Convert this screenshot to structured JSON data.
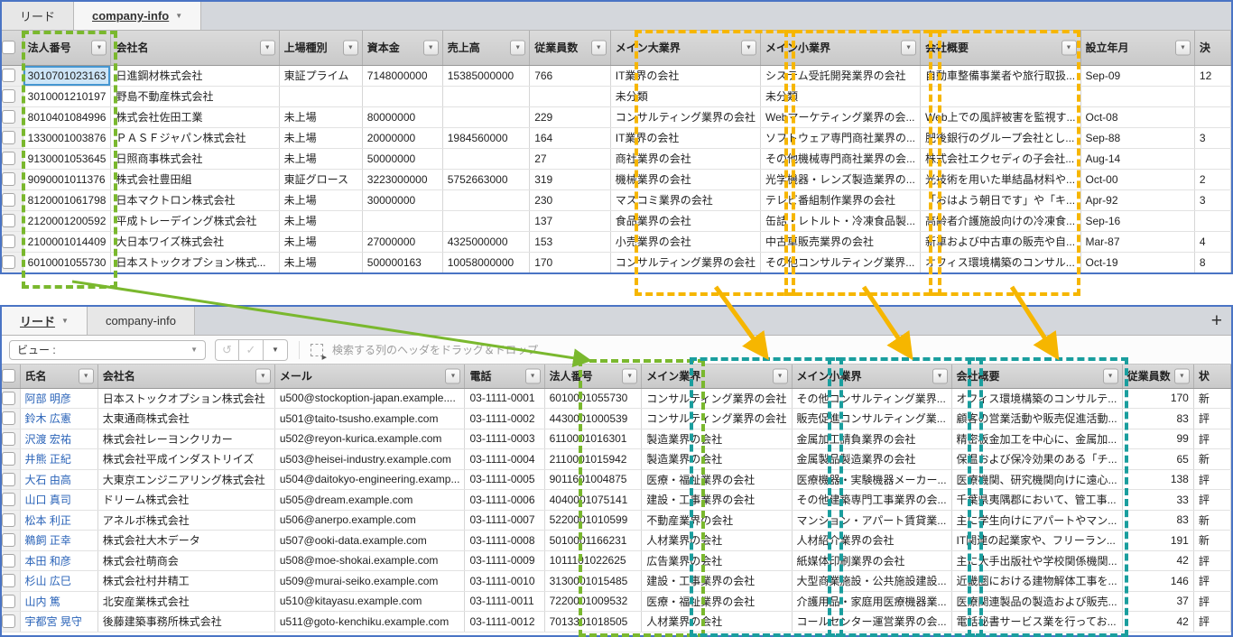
{
  "colors": {
    "panel_border": "#4a74c4",
    "green": "#7ab82e",
    "yellow": "#f6b600",
    "teal": "#1a9e9e",
    "link": "#2a63b8",
    "selected_cell_bg": "#cde5f7",
    "selected_cell_border": "#4596d1"
  },
  "top_panel": {
    "tabs": [
      {
        "id": "lead",
        "label": "リード",
        "active": false,
        "caret": false
      },
      {
        "id": "company-info",
        "label": "company-info",
        "active": true,
        "caret": true
      }
    ],
    "columns": [
      {
        "id": "corporate-number",
        "label": "法人番号"
      },
      {
        "id": "company-name",
        "label": "会社名"
      },
      {
        "id": "listing-type",
        "label": "上場種別"
      },
      {
        "id": "capital",
        "label": "資本金"
      },
      {
        "id": "revenue",
        "label": "売上高"
      },
      {
        "id": "employees",
        "label": "従業員数"
      },
      {
        "id": "main-major-industry",
        "label": "メイン大業界"
      },
      {
        "id": "main-minor-industry",
        "label": "メイン小業界"
      },
      {
        "id": "company-overview",
        "label": "会社概要"
      },
      {
        "id": "founded",
        "label": "設立年月"
      },
      {
        "id": "fiscal-month",
        "label": "決",
        "cut": true
      }
    ],
    "rows": [
      [
        "3010701023163",
        "日進鋼材株式会社",
        "東証プライム",
        "7148000000",
        "15385000000",
        "766",
        "IT業界の会社",
        "システム受託開発業界の会社",
        "自動車整備事業者や旅行取扱...",
        "Sep-09",
        "12"
      ],
      [
        "3010001210197",
        "野島不動産株式会社",
        "",
        "",
        "",
        "",
        "未分類",
        "未分類",
        "",
        "",
        ""
      ],
      [
        "8010401084996",
        "株式会社佐田工業",
        "未上場",
        "80000000",
        "",
        "229",
        "コンサルティング業界の会社",
        "Webマーケティング業界の会...",
        "Web上での風評被害を監視す...",
        "Oct-08",
        ""
      ],
      [
        "1330001003876",
        "ＰＡＳＦジャパン株式会社",
        "未上場",
        "20000000",
        "1984560000",
        "164",
        "IT業界の会社",
        "ソフトウェア専門商社業界の...",
        "肥後銀行のグループ会社とし...",
        "Sep-88",
        "3"
      ],
      [
        "9130001053645",
        "日照商事株式会社",
        "未上場",
        "50000000",
        "",
        "27",
        "商社業界の会社",
        "その他機械専門商社業界の会...",
        "株式会社エクセディの子会社...",
        "Aug-14",
        ""
      ],
      [
        "9090001011376",
        "株式会社豊田組",
        "東証グロース",
        "3223000000",
        "5752663000",
        "319",
        "機械業界の会社",
        "光学機器・レンズ製造業界の...",
        "光技術を用いた単結晶材料や...",
        "Oct-00",
        "2"
      ],
      [
        "8120001061798",
        "日本マクトロン株式会社",
        "未上場",
        "30000000",
        "",
        "230",
        "マスコミ業界の会社",
        "テレビ番組制作業界の会社",
        "「おはよう朝日です」や「キ...",
        "Apr-92",
        "3"
      ],
      [
        "2120001200592",
        "平成トレーデイング株式会社",
        "未上場",
        "",
        "",
        "137",
        "食品業界の会社",
        "缶詰・レトルト・冷凍食品製...",
        "高齢者介護施設向けの冷凍食...",
        "Sep-16",
        ""
      ],
      [
        "2100001014409",
        "大日本ワイズ株式会社",
        "未上場",
        "27000000",
        "4325000000",
        "153",
        "小売業界の会社",
        "中古車販売業界の会社",
        "新車および中古車の販売や自...",
        "Mar-87",
        "4"
      ],
      [
        "6010001055730",
        "日本ストックオプション株式...",
        "未上場",
        "500000163",
        "10058000000",
        "170",
        "コンサルティング業界の会社",
        "その他コンサルティング業界...",
        "オフィス環境構築のコンサル...",
        "Oct-19",
        "8"
      ]
    ]
  },
  "bottom_panel": {
    "tabs": [
      {
        "id": "lead",
        "label": "リード",
        "active": true,
        "caret": true
      },
      {
        "id": "company-info",
        "label": "company-info",
        "active": false,
        "caret": false
      }
    ],
    "add_tab_icon": "+",
    "toolbar": {
      "view_label": "ビュー :",
      "undo_icon": "↺",
      "confirm_icon": "✓",
      "caret_icon": "▼",
      "drag_hint": "検索する列のヘッダをドラッグ＆ドロップ"
    },
    "columns": [
      {
        "id": "full-name",
        "label": "氏名"
      },
      {
        "id": "company-name",
        "label": "会社名"
      },
      {
        "id": "email",
        "label": "メール"
      },
      {
        "id": "phone",
        "label": "電話"
      },
      {
        "id": "corporate-number",
        "label": "法人番号"
      },
      {
        "id": "main-industry",
        "label": "メイン業界"
      },
      {
        "id": "main-minor-industry",
        "label": "メイン小業界"
      },
      {
        "id": "company-overview",
        "label": "会社概要"
      },
      {
        "id": "employees",
        "label": "従業員数"
      },
      {
        "id": "status",
        "label": "状",
        "cut": true
      }
    ],
    "rows": [
      [
        "阿部 明彦",
        "日本ストックオプション株式会社",
        "u500@stockoption-japan.example....",
        "03-1111-0001",
        "6010001055730",
        "コンサルティング業界の会社",
        "その他コンサルティング業界...",
        "オフィス環境構築のコンサルテ...",
        "170",
        "新"
      ],
      [
        "鈴木 広憲",
        "太東通商株式会社",
        "u501@taito-tsusho.example.com",
        "03-1111-0002",
        "4430001000539",
        "コンサルティング業界の会社",
        "販売促進コンサルティング業...",
        "顧客の営業活動や販売促進活動...",
        "83",
        "評"
      ],
      [
        "沢渡 宏祐",
        "株式会社レーヨンクリカー",
        "u502@reyon-kurica.example.com",
        "03-1111-0003",
        "6110001016301",
        "製造業界の会社",
        "金属加工請負業界の会社",
        "精密板金加工を中心に、金属加...",
        "99",
        "評"
      ],
      [
        "井熊 正紀",
        "株式会社平成インダストリイズ",
        "u503@heisei-industry.example.com",
        "03-1111-0004",
        "2110001015942",
        "製造業界の会社",
        "金属製品製造業界の会社",
        "保温および保冷効果のある「チ...",
        "65",
        "新"
      ],
      [
        "大石 由高",
        "大東京エンジニアリング株式会社",
        "u504@daitokyo-engineering.examp...",
        "03-1111-0005",
        "9011601004875",
        "医療・福祉業界の会社",
        "医療機器・実験機器メーカー...",
        "医療機関、研究機関向けに遠心...",
        "138",
        "評"
      ],
      [
        "山口 真司",
        "ドリーム株式会社",
        "u505@dream.example.com",
        "03-1111-0006",
        "4040001075141",
        "建設・工事業界の会社",
        "その他建築専門工事業界の会...",
        "千葉県夷隅郡において、管工事...",
        "33",
        "評"
      ],
      [
        "松本 利正",
        "アネルボ株式会社",
        "u506@anerpo.example.com",
        "03-1111-0007",
        "5220001010599",
        "不動産業界の会社",
        "マンション・アパート賃貸業...",
        "主に学生向けにアパートやマン...",
        "83",
        "新"
      ],
      [
        "鵜飼 正幸",
        "株式会社大木データ",
        "u507@ooki-data.example.com",
        "03-1111-0008",
        "5010001166231",
        "人材業界の会社",
        "人材紹介業界の会社",
        "IT関連の起業家や、フリーラン...",
        "191",
        "新"
      ],
      [
        "本田 和彦",
        "株式会社萌商会",
        "u508@moe-shokai.example.com",
        "03-1111-0009",
        "1011101022625",
        "広告業界の会社",
        "紙媒体印刷業界の会社",
        "主に大手出版社や学校関係機関...",
        "42",
        "評"
      ],
      [
        "杉山 広巳",
        "株式会社村井精工",
        "u509@murai-seiko.example.com",
        "03-1111-0010",
        "3130001015485",
        "建設・工事業界の会社",
        "大型商業施設・公共施設建設...",
        "近畿圏における建物解体工事を...",
        "146",
        "評"
      ],
      [
        "山内 篤",
        "北安産業株式会社",
        "u510@kitayasu.example.com",
        "03-1111-0011",
        "7220001009532",
        "医療・福祉業界の会社",
        "介護用品・家庭用医療機器業...",
        "医療関連製品の製造および販売...",
        "37",
        "評"
      ],
      [
        "宇都宮 晃守",
        "後藤建築事務所株式会社",
        "u511@goto-kenchiku.example.com",
        "03-1111-0012",
        "7013301018505",
        "人材業界の会社",
        "コールセンター運営業界の会...",
        "電話秘書サービス業を行ってお...",
        "42",
        "評"
      ]
    ]
  }
}
